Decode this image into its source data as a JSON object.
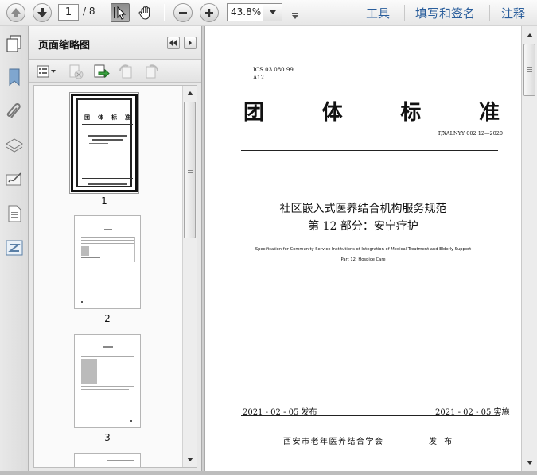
{
  "toolbar": {
    "current_page": "1",
    "page_total": "/ 8",
    "zoom": "43.8%",
    "menu_tools": "工具",
    "menu_fill_sign": "填写和签名",
    "menu_comment": "注释"
  },
  "panel": {
    "title": "页面缩略图",
    "thumbnails": [
      {
        "number": "1",
        "selected": true
      },
      {
        "number": "2",
        "selected": false
      },
      {
        "number": "3",
        "selected": false
      }
    ]
  },
  "document": {
    "ics_line": "ICS 03.080.99",
    "class_line": "A12",
    "title_chars": [
      "团",
      "体",
      "标",
      "准"
    ],
    "standard_number": "T/XALNYY 002.12—2020",
    "cn_title_line1": "社区嵌入式医养结合机构服务规范",
    "cn_title_line2": "第 12 部分：安宁疗护",
    "en_title_line1": "Specification for Community Service Institutions of Integration of Medical Treatment and Elderly Support",
    "en_title_line2": "Part 12: Hospice Care",
    "publish_date": "2021 - 02 - 05 发布",
    "implement_date": "2021 - 02 - 05 实施",
    "issuer": "西安市老年医养结合学会",
    "issue_word": "发 布"
  },
  "icons": [
    "arrow-up-icon",
    "arrow-down-icon",
    "select-cursor-icon",
    "hand-icon",
    "zoom-out-icon",
    "zoom-in-icon",
    "pages-icon",
    "bookmark-icon",
    "paperclip-icon",
    "layers-icon",
    "signature-icon",
    "document-icon",
    "compare-icon",
    "options-icon",
    "delete-icon",
    "extract-icon",
    "rotate-left-icon",
    "rotate-right-icon"
  ]
}
